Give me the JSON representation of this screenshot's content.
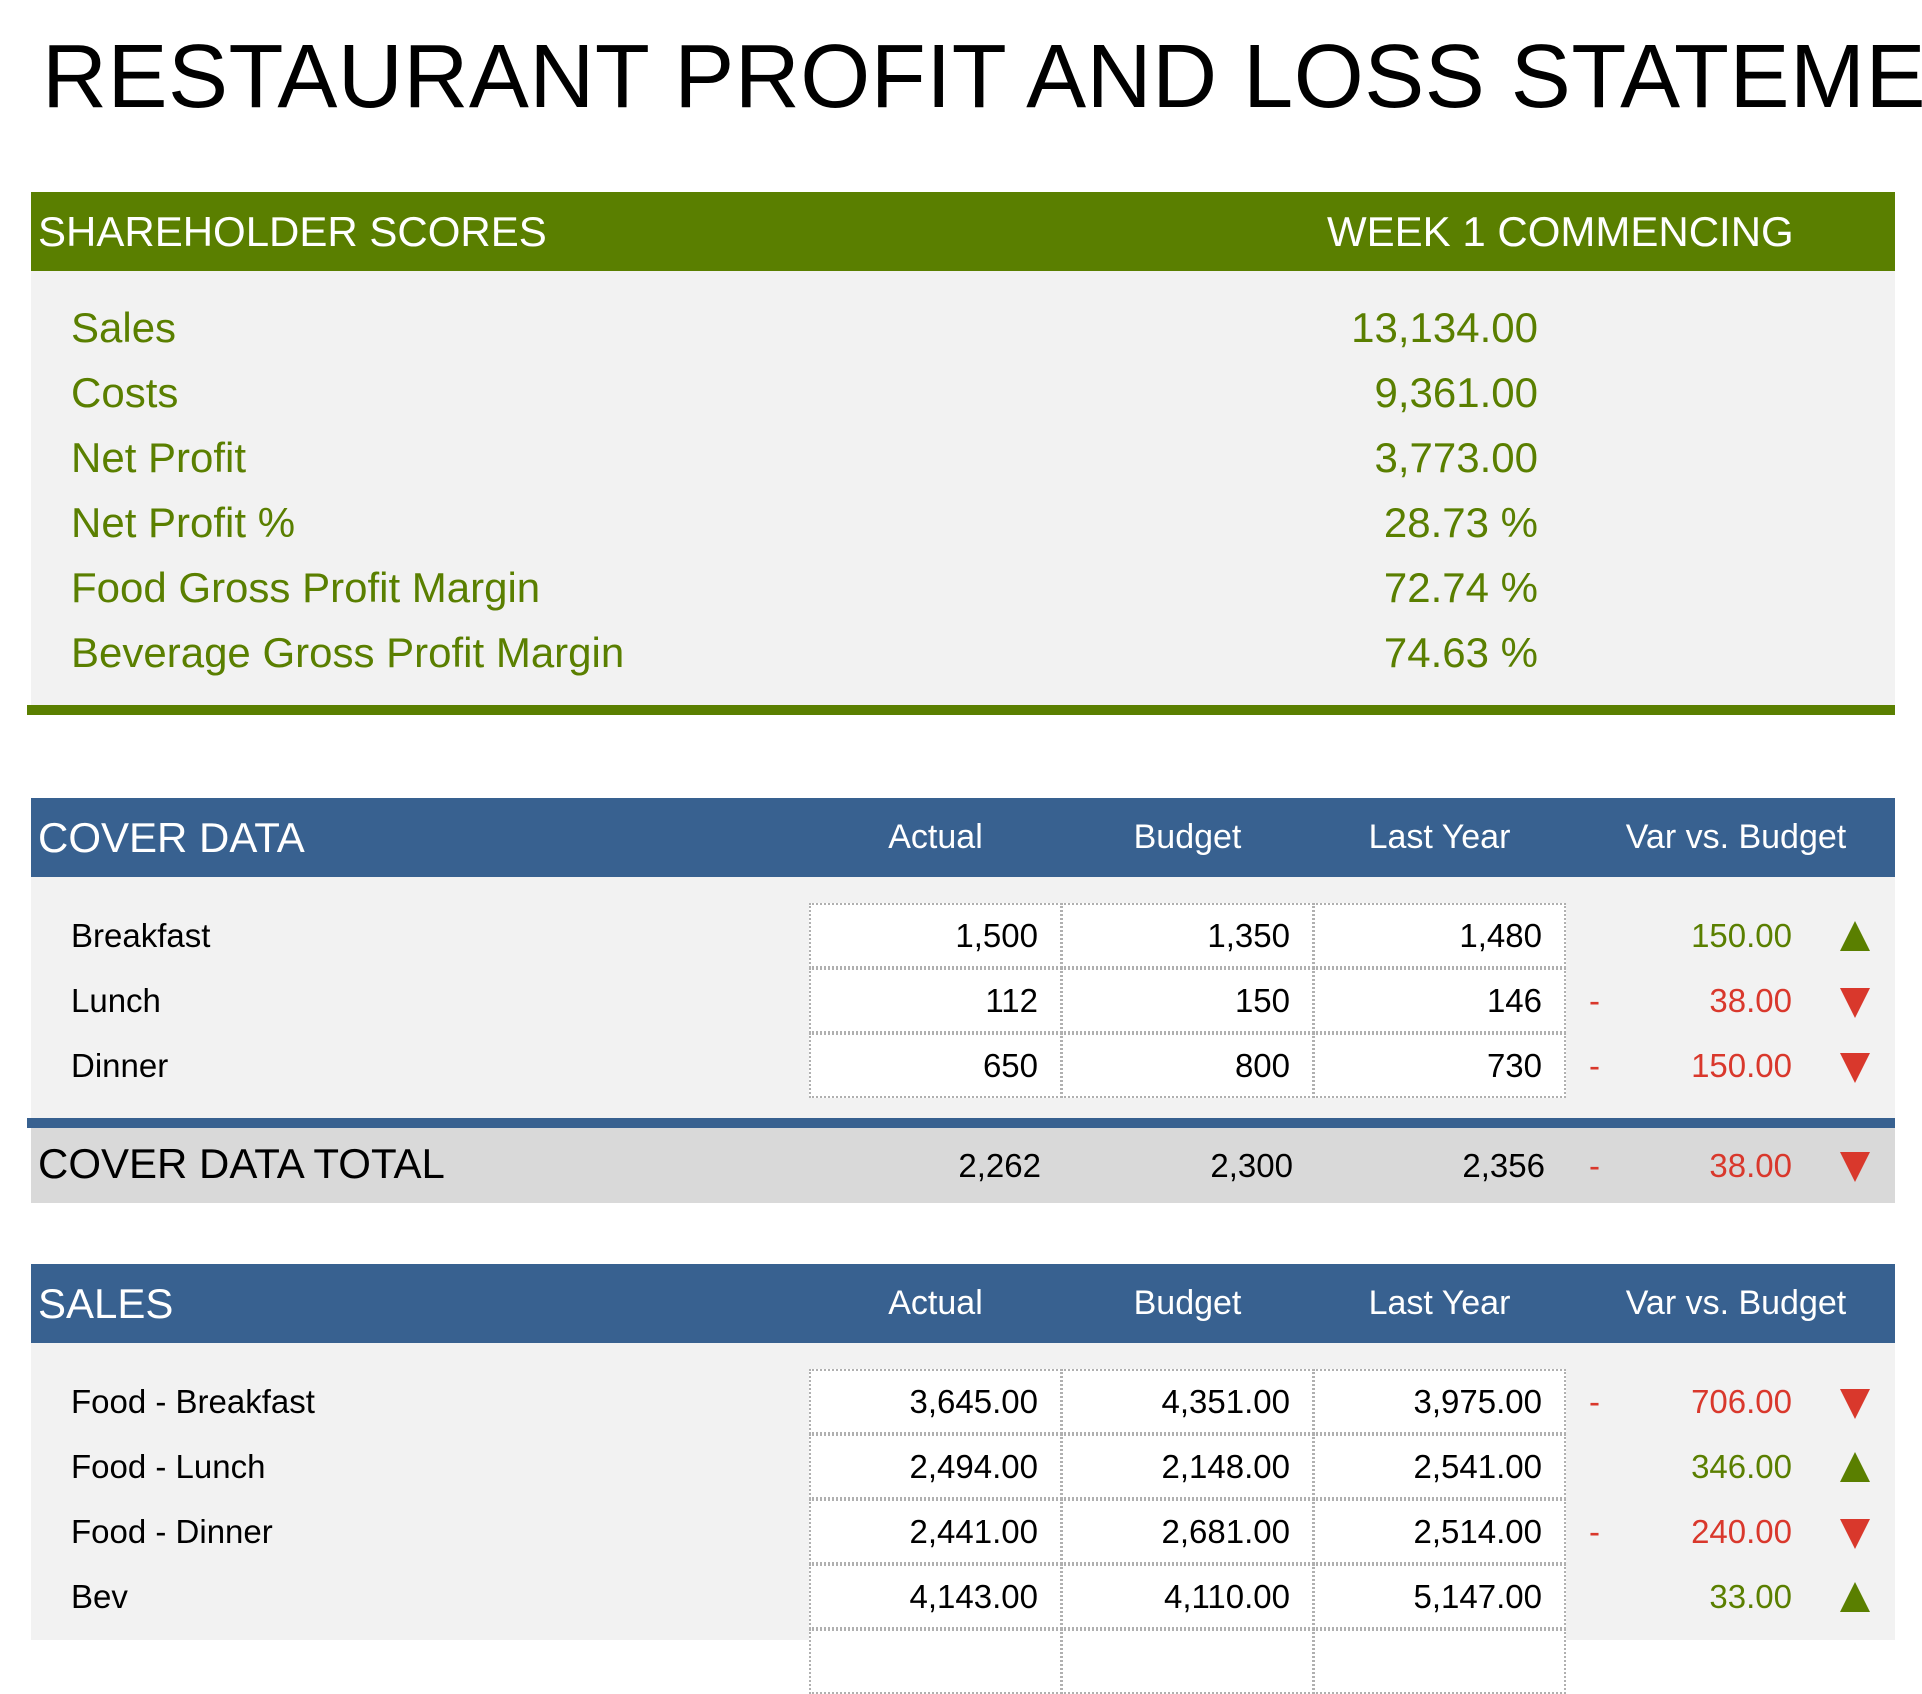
{
  "title": "RESTAURANT PROFIT AND LOSS STATEMENT",
  "colors": {
    "green": "#5a7f00",
    "blue": "#386190",
    "red": "#d9382c",
    "panel_bg": "#f2f2f2",
    "total_bg": "#d9d9d9"
  },
  "shareholder": {
    "header_left": "SHAREHOLDER SCORES",
    "header_right": "WEEK 1 COMMENCING",
    "rows": [
      {
        "label": "Sales",
        "value": "13,134.00"
      },
      {
        "label": "Costs",
        "value": "9,361.00"
      },
      {
        "label": "Net Profit",
        "value": "3,773.00"
      },
      {
        "label": "Net Profit %",
        "value": "28.73  %"
      },
      {
        "label": "Food Gross Profit Margin",
        "value": "72.74  %"
      },
      {
        "label": "Beverage Gross Profit Margin",
        "value": "74.63  %"
      }
    ]
  },
  "cover_data": {
    "title": "COVER DATA",
    "columns": [
      "Actual",
      "Budget",
      "Last Year",
      "Var vs. Budget"
    ],
    "rows": [
      {
        "label": "Breakfast",
        "actual": "1,500",
        "budget": "1,350",
        "last_year": "1,480",
        "sign": "",
        "var": "150.00",
        "trend": "up-icon"
      },
      {
        "label": "Lunch",
        "actual": "112",
        "budget": "150",
        "last_year": "146",
        "sign": "-",
        "var": "38.00",
        "trend": "down-icon"
      },
      {
        "label": "Dinner",
        "actual": "650",
        "budget": "800",
        "last_year": "730",
        "sign": "-",
        "var": "150.00",
        "trend": "down-icon"
      }
    ],
    "total": {
      "label": "COVER DATA TOTAL",
      "actual": "2,262",
      "budget": "2,300",
      "last_year": "2,356",
      "sign": "-",
      "var": "38.00",
      "trend": "down-icon"
    }
  },
  "sales": {
    "title": "SALES",
    "columns": [
      "Actual",
      "Budget",
      "Last Year",
      "Var vs. Budget"
    ],
    "rows": [
      {
        "label": "Food - Breakfast",
        "actual": "3,645.00",
        "budget": "4,351.00",
        "last_year": "3,975.00",
        "sign": "-",
        "var": "706.00",
        "trend": "down-icon"
      },
      {
        "label": "Food - Lunch",
        "actual": "2,494.00",
        "budget": "2,148.00",
        "last_year": "2,541.00",
        "sign": "",
        "var": "346.00",
        "trend": "up-icon"
      },
      {
        "label": "Food - Dinner",
        "actual": "2,441.00",
        "budget": "2,681.00",
        "last_year": "2,514.00",
        "sign": "-",
        "var": "240.00",
        "trend": "down-icon"
      },
      {
        "label": "Bev",
        "actual": "4,143.00",
        "budget": "4,110.00",
        "last_year": "5,147.00",
        "sign": "",
        "var": "33.00",
        "trend": "up-icon"
      }
    ]
  }
}
